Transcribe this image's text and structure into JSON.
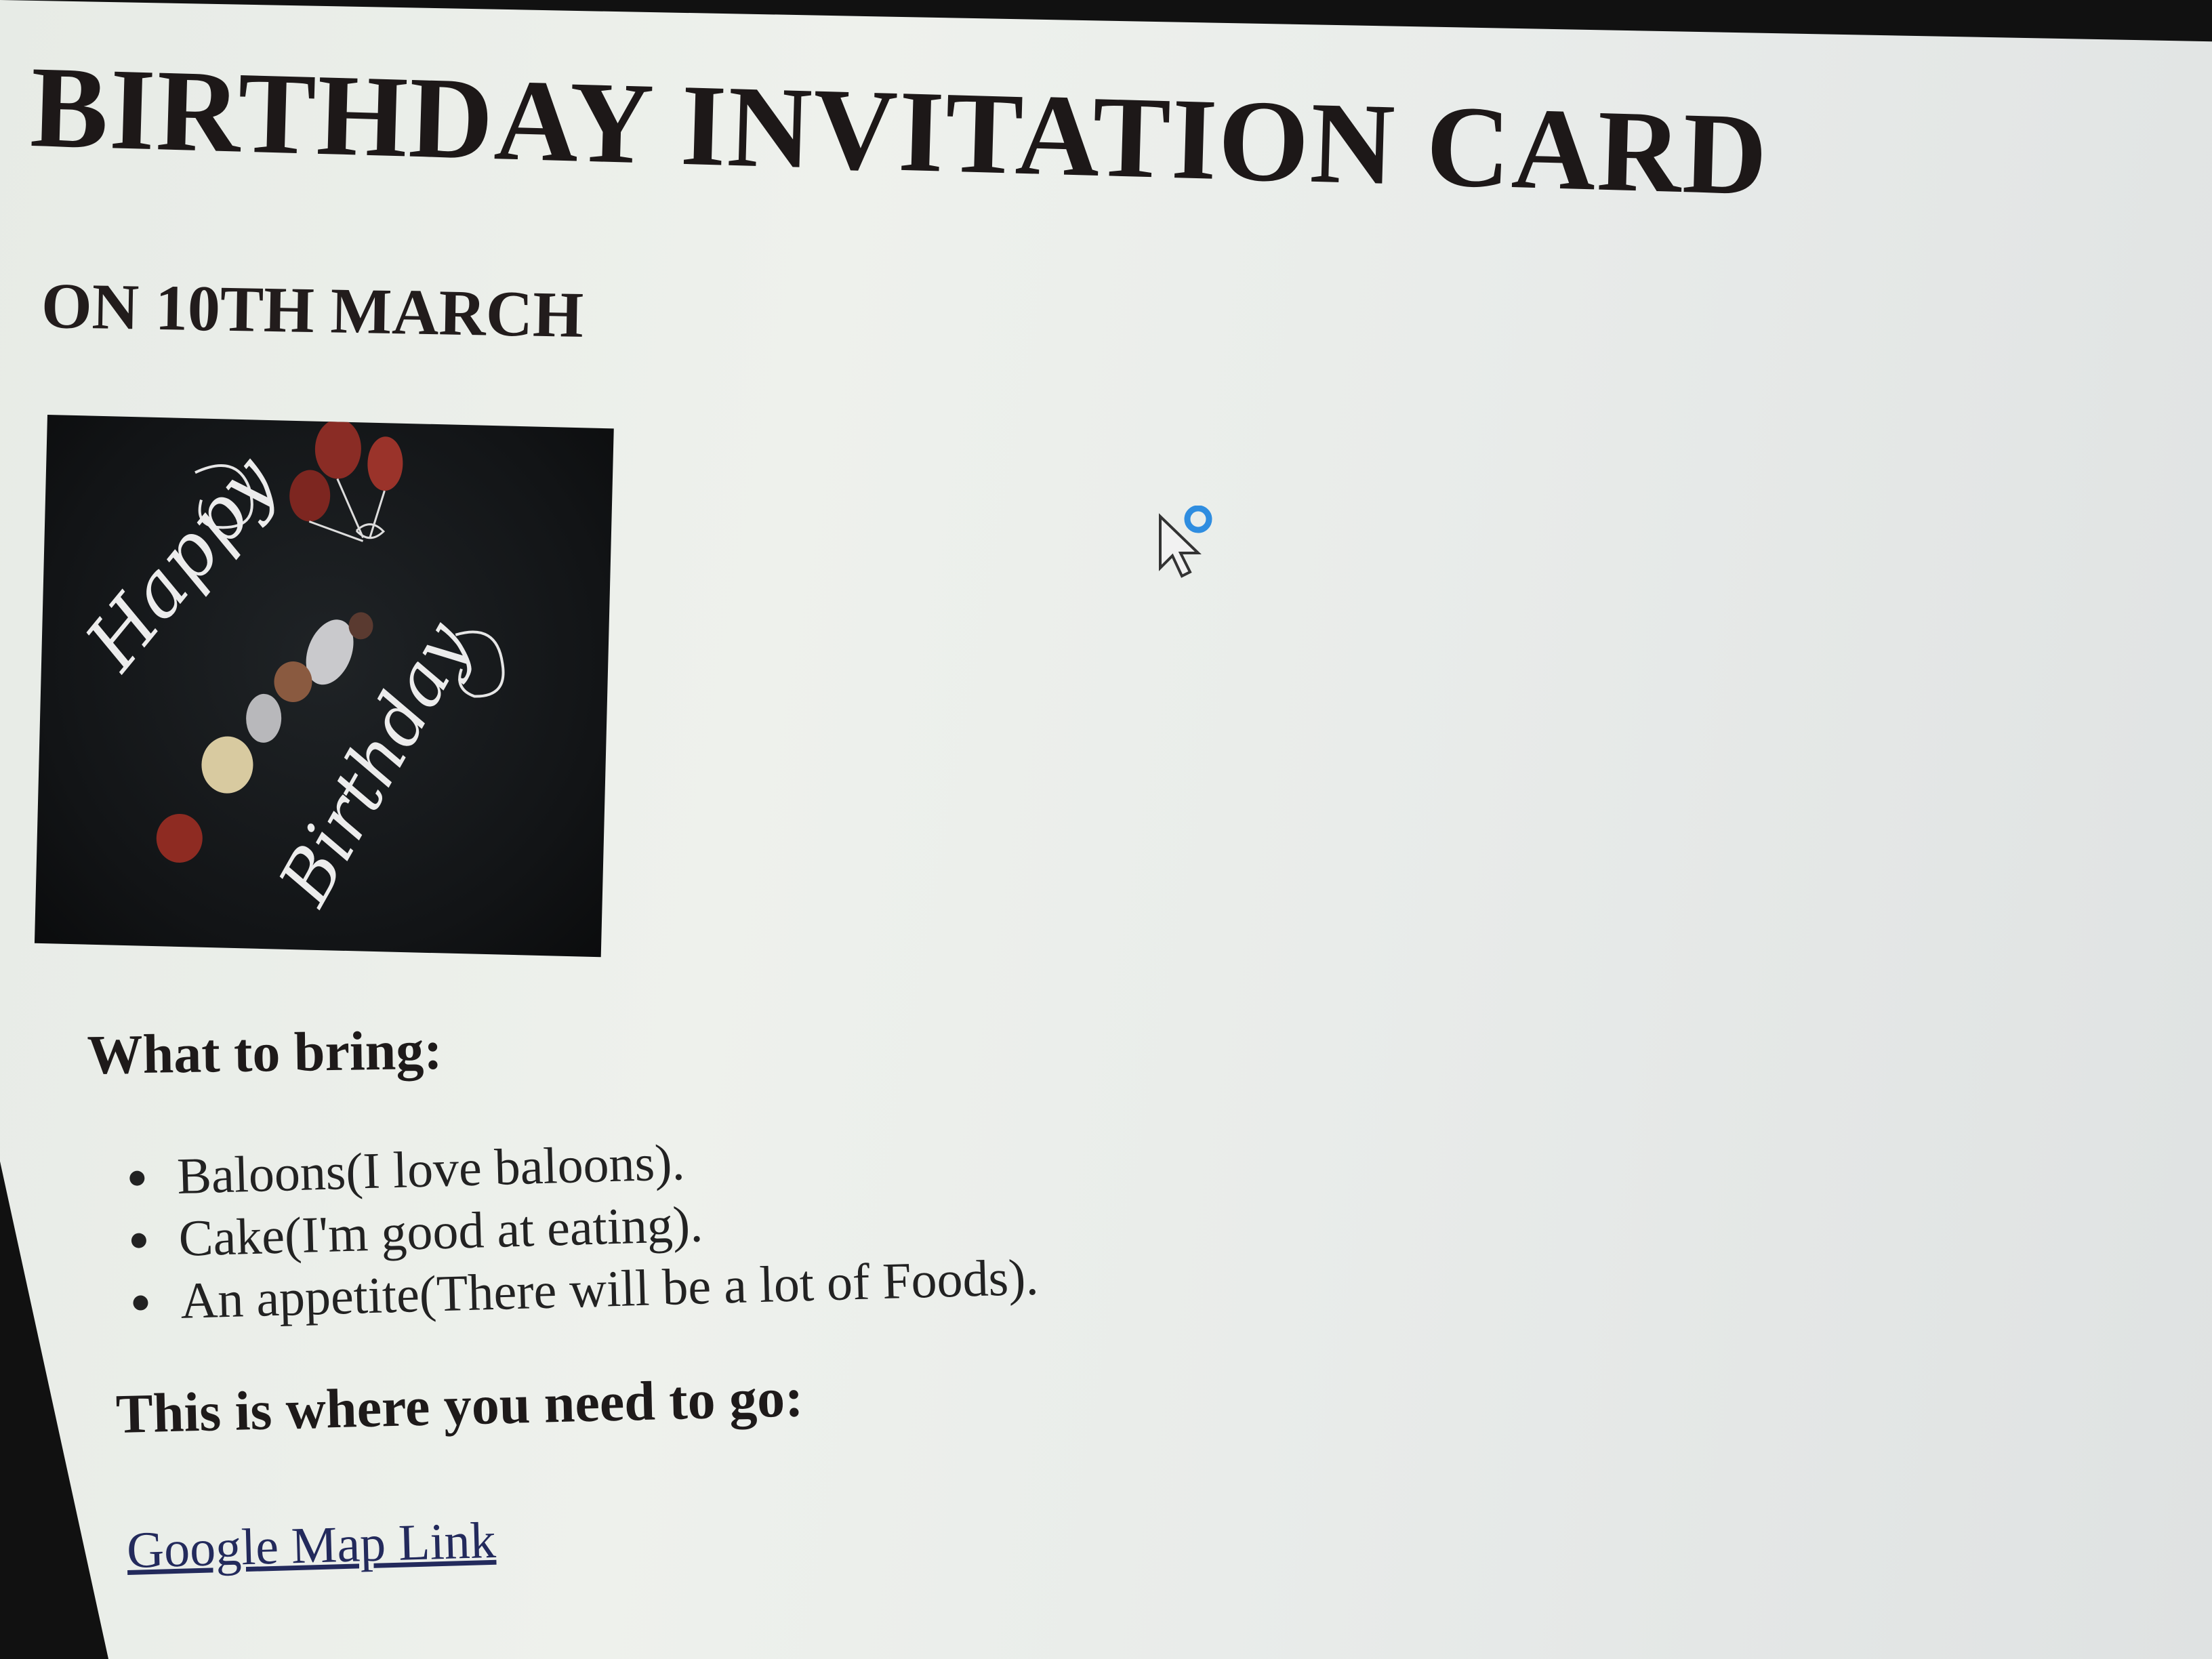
{
  "page": {
    "title": "BIRTHDAY INVITATION CARD",
    "date_line": "ON 10TH MARCH"
  },
  "image": {
    "text_line1": "Happy",
    "text_line2": "Birthday"
  },
  "bring": {
    "heading": "What to bring:",
    "items": [
      "Baloons(I love baloons).",
      "Cake(I'm good at eating).",
      "An appetite(There will be a lot of Foods)."
    ]
  },
  "location": {
    "heading": "This is where you need to go:",
    "link_label": "Google Map Link"
  }
}
